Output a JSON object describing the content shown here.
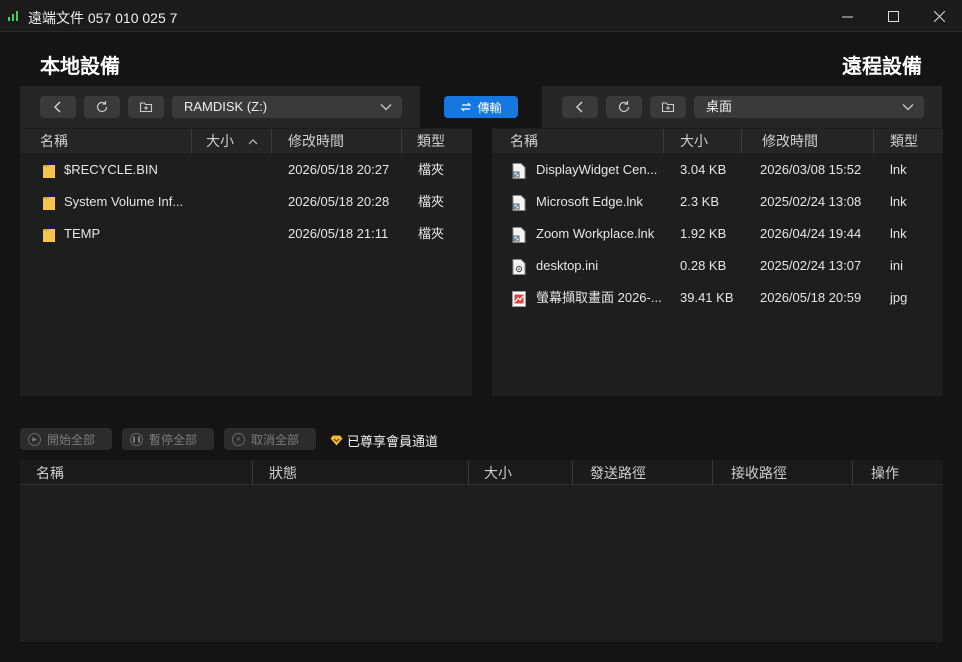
{
  "window": {
    "title": "遠端文件 057 010 025 7",
    "signal_icon": "signal-bars-icon",
    "signal_color": "#3bd16f"
  },
  "local": {
    "title": "本地設備",
    "drive": "RAMDISK (Z:)",
    "columns": [
      "名稱",
      "大小",
      "修改時間",
      "類型"
    ],
    "files": [
      {
        "name": "$RECYCLE.BIN",
        "size": "",
        "modified": "2026/05/18 20:27",
        "type": "檔夾",
        "icon": "folder-icon"
      },
      {
        "name": "System Volume Inf...",
        "size": "",
        "modified": "2026/05/18 20:28",
        "type": "檔夾",
        "icon": "folder-icon"
      },
      {
        "name": "TEMP",
        "size": "",
        "modified": "2026/05/18 21:11",
        "type": "檔夾",
        "icon": "folder-icon"
      }
    ]
  },
  "transfer_label": "傳輸",
  "remote": {
    "title": "遠程設備",
    "location": "桌面",
    "columns": [
      "名稱",
      "大小",
      "修改時間",
      "類型"
    ],
    "files": [
      {
        "name": "DisplayWidget Cen...",
        "size": "3.04 KB",
        "modified": "2026/03/08 15:52",
        "type": "lnk",
        "icon": "shortcut-file-icon"
      },
      {
        "name": "Microsoft Edge.lnk",
        "size": "2.3 KB",
        "modified": "2025/02/24 13:08",
        "type": "lnk",
        "icon": "shortcut-file-icon"
      },
      {
        "name": "Zoom Workplace.lnk",
        "size": "1.92 KB",
        "modified": "2026/04/24 19:44",
        "type": "lnk",
        "icon": "shortcut-file-icon"
      },
      {
        "name": "desktop.ini",
        "size": "0.28 KB",
        "modified": "2025/02/24 13:07",
        "type": "ini",
        "icon": "settings-file-icon"
      },
      {
        "name": "螢幕擷取畫面 2026-...",
        "size": "39.41 KB",
        "modified": "2026/05/18 20:59",
        "type": "jpg",
        "icon": "image-file-icon"
      }
    ]
  },
  "queue": {
    "start_all": "開始全部",
    "pause_all": "暫停全部",
    "cancel_all": "取消全部",
    "vip_label": "已尊享會員通道",
    "columns": [
      "名稱",
      "狀態",
      "大小",
      "發送路徑",
      "接收路徑",
      "操作"
    ]
  },
  "colors": {
    "accent": "#1677e0",
    "folder": "#f3c549",
    "vip": "#f0b93a"
  }
}
